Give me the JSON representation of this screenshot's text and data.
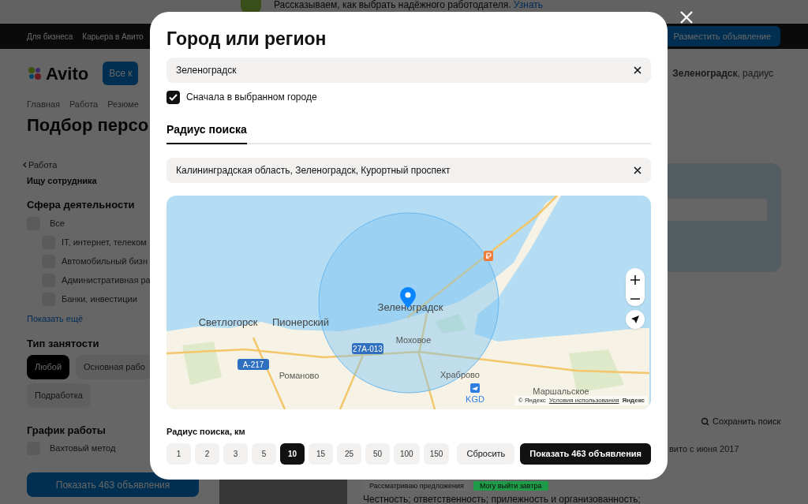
{
  "promo_banner": {
    "text": "Рассказываем, как выбрать надёжного работодателя.",
    "link": "Узнать"
  },
  "top_nav": {
    "links": [
      "Для бизнеса",
      "Карьера в Авито"
    ],
    "post_button": "Разместить объявление"
  },
  "header": {
    "logo": "Avito",
    "catalog_button": "Все к",
    "location": "**Зеленоградск**, радиус"
  },
  "breadcrumbs": [
    "Главная",
    "Работа",
    "Резюме"
  ],
  "page_title": "Подбор персо",
  "sidebar": {
    "back_link": "Работа",
    "role": "Ищу сотрудника",
    "activity": {
      "title": "Сфера деятельности",
      "items": [
        {
          "label": "Все",
          "checked": false,
          "children": [
            {
              "label": "IT, интернет, телеком",
              "checked": false
            },
            {
              "label": "Автомобильный бизн",
              "checked": false
            },
            {
              "label": "Административная ра",
              "checked": false
            },
            {
              "label": "Банки, инвестиции",
              "checked": false
            }
          ]
        }
      ],
      "more_link": "Показать ещё"
    },
    "employment": {
      "title": "Тип занятости",
      "chips": [
        {
          "label": "Любой",
          "selected": true
        },
        {
          "label": "Основная рабо",
          "selected": false
        },
        {
          "label": "Подработка",
          "selected": false
        }
      ]
    },
    "schedule": {
      "title": "График работы",
      "items": [
        {
          "label": "Вахтовый метод",
          "checked": false
        }
      ]
    },
    "submit_button": "Показать 463 объявления"
  },
  "results": {
    "save_search": "Сохранить поиск",
    "seller_since": "вито с июня 2017",
    "tags": [
      {
        "label": "Рассматриваю предложения",
        "color": "#6a6a6a"
      },
      {
        "label": "Могу выйти завтра",
        "color": "#1f9a48"
      }
    ],
    "description": "Честность; ответственность; прилежность и организованность;"
  },
  "modal": {
    "title": "Город или регион",
    "city_field": {
      "value": "Зеленоградск"
    },
    "first_in_city": {
      "label": "Сначала в выбранном городе",
      "checked": true
    },
    "tabs": [
      {
        "label": "Радиус поиска",
        "selected": true
      }
    ],
    "address_field": {
      "value": "Калининградская область, Зеленоградск, Курортный проспект"
    },
    "map": {
      "labels": [
        {
          "text": "Зеленоградск",
          "kind": "city"
        },
        {
          "text": "Светлогорск",
          "kind": "city"
        },
        {
          "text": "Пионерский",
          "kind": "city"
        },
        {
          "text": "Моховое",
          "kind": "town"
        },
        {
          "text": "27А-013",
          "kind": "road"
        },
        {
          "text": "А-217",
          "kind": "road"
        },
        {
          "text": "Романово",
          "kind": "town"
        },
        {
          "text": "Храброво",
          "kind": "town"
        },
        {
          "text": "KGD",
          "kind": "airport"
        },
        {
          "text": "Маршальское",
          "kind": "town"
        }
      ],
      "attribution": {
        "copyright": "© Яндекс",
        "terms_link": "Условия использования",
        "brand": "Яндекс"
      }
    },
    "radius": {
      "label": "Радиус поиска, км",
      "options": [
        {
          "label": "1",
          "selected": false
        },
        {
          "label": "2",
          "selected": false
        },
        {
          "label": "3",
          "selected": false
        },
        {
          "label": "5",
          "selected": false
        },
        {
          "label": "10",
          "selected": true
        },
        {
          "label": "15",
          "selected": false
        },
        {
          "label": "25",
          "selected": false
        },
        {
          "label": "50",
          "selected": false
        },
        {
          "label": "100",
          "selected": false
        },
        {
          "label": "150",
          "selected": false
        }
      ]
    },
    "reset_button": "Сбросить",
    "submit_button": "Показать 463 объявления"
  }
}
